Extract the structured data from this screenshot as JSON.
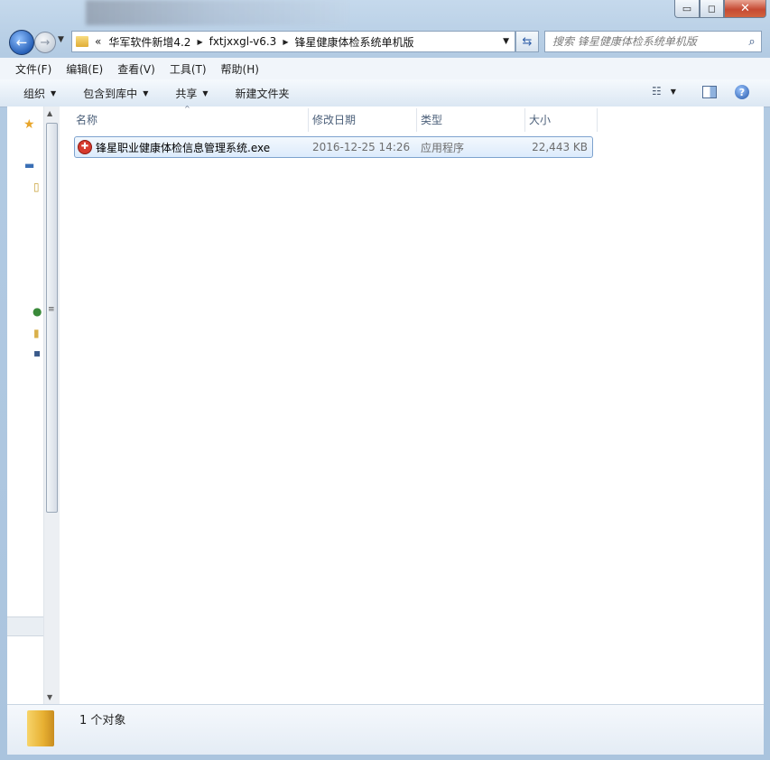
{
  "window": {
    "min_label": "▭",
    "max_label": "◻",
    "close_label": "✕"
  },
  "address": {
    "chev": "«",
    "crumbs": [
      "华军软件新增4.2",
      "fxtjxxgl-v6.3",
      "锋星健康体检系统单机版"
    ]
  },
  "search": {
    "placeholder": "搜索 锋星健康体检系统单机版"
  },
  "menu": {
    "file": "文件(F)",
    "edit": "编辑(E)",
    "view": "查看(V)",
    "tools": "工具(T)",
    "help": "帮助(H)"
  },
  "commands": {
    "organize": "组织",
    "include_library": "包含到库中",
    "share": "共享",
    "new_folder": "新建文件夹"
  },
  "columns": {
    "name": "名称",
    "date": "修改日期",
    "type": "类型",
    "size": "大小"
  },
  "files": [
    {
      "name": "锋星职业健康体检信息管理系统.exe",
      "date": "2016-12-25 14:26",
      "type": "应用程序",
      "size": "22,443 KB",
      "icon": "exe-icon"
    }
  ],
  "status": {
    "count_text": "1 个对象"
  },
  "colors": {
    "accent": "#2861b8",
    "selection": "#dcebfc"
  }
}
